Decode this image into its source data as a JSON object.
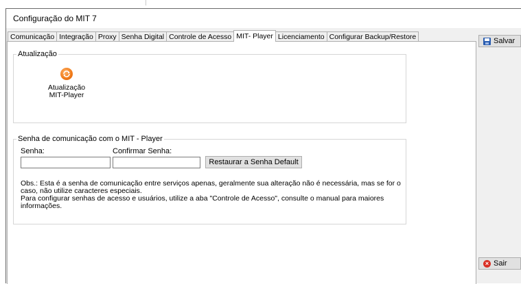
{
  "window": {
    "title": "Configuração do MIT 7"
  },
  "tabs": [
    {
      "label": "Comunicação",
      "active": false
    },
    {
      "label": "Integração",
      "active": false
    },
    {
      "label": "Proxy",
      "active": false
    },
    {
      "label": "Senha Digital",
      "active": false
    },
    {
      "label": "Controle de Acesso",
      "active": false
    },
    {
      "label": "MIT- Player",
      "active": true
    },
    {
      "label": "Licenciamento",
      "active": false
    },
    {
      "label": "Configurar Backup/Restore",
      "active": false
    }
  ],
  "update_group": {
    "legend": "Atualização",
    "button_line1": "Atualização",
    "button_line2": "MIT-Player",
    "icon": "refresh-icon"
  },
  "password_group": {
    "legend": "Senha de comunicação com o MIT - Player",
    "password_label": "Senha:",
    "password_value": "",
    "confirm_label": "Confirmar Senha:",
    "confirm_value": "",
    "restore_button": "Restaurar a Senha Default",
    "obs_line1": "Obs.: Esta é a senha de comunicação entre serviços apenas, geralmente sua alteração não é necessária, mas se for o caso, não utilize caracteres especiais.",
    "obs_line2": "Para configurar senhas de acesso e usuários, utilize a aba \"Controle de Acesso\", consulte o manual para maiores informações."
  },
  "actions": {
    "save_label": "Salvar",
    "save_icon": "floppy-disk-icon",
    "exit_label": "Sair",
    "exit_icon": "close-circle-icon"
  }
}
